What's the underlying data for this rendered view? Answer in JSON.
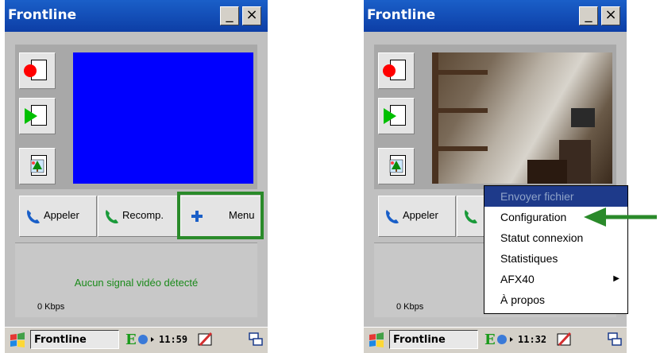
{
  "left": {
    "title": "Frontline",
    "minimize": "_",
    "close": "×",
    "buttons": {
      "call": "Appeler",
      "redial": "Recomp.",
      "menu": "Menu"
    },
    "status_message": "Aucun signal vidéo détecté",
    "bitrate": "0 Kbps",
    "taskbar": {
      "app": "Frontline",
      "clock": "11:59"
    }
  },
  "right": {
    "title": "Frontline",
    "minimize": "_",
    "close": "×",
    "buttons": {
      "call": "Appeler"
    },
    "bitrate": "0 Kbps",
    "taskbar": {
      "app": "Frontline",
      "clock": "11:32"
    },
    "menu": {
      "items": [
        {
          "label": "Envoyer fichier"
        },
        {
          "label": "Configuration"
        },
        {
          "label": "Statut connexion"
        },
        {
          "label": "Statistiques"
        },
        {
          "label": "AFX40"
        },
        {
          "label": "À propos"
        }
      ]
    }
  },
  "colors": {
    "accent_highlight": "#2a8a2a",
    "video_blank": "#0000ff",
    "title_bar": "#1a5fc8",
    "menu_selected": "#1e3a8a"
  }
}
